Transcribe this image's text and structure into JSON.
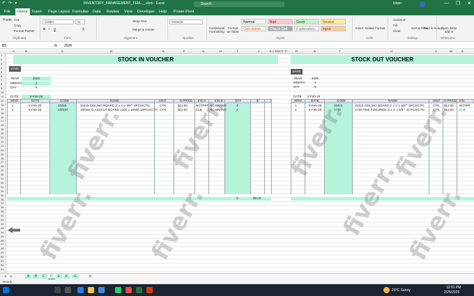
{
  "titlebar": {
    "qa": [
      "↶",
      "↷",
      "▾"
    ],
    "doc_title": "INVENTORY_MANAGEMENT_TEM..._.xlsm  ·  Excel",
    "search": "Search",
    "user": "Islam",
    "win": [
      "—",
      "❐",
      "✕"
    ]
  },
  "tabs": [
    "File",
    "Home",
    "Insert",
    "Page Layout",
    "Formulas",
    "Data",
    "Review",
    "View",
    "Developer",
    "Help",
    "Power Pivot"
  ],
  "ribbon": {
    "clipboard": [
      "Paste",
      "Cut",
      "Copy",
      "Format Painter"
    ],
    "font_name": "Calibri",
    "font_size": "11",
    "wrap_text": "Wrap Text",
    "merge": "Merge & Center",
    "number_format": "General",
    "cond_format": "Conditional Formatting",
    "format_table": "Format as Table",
    "styles": [
      "Normal",
      "Bad",
      "Good",
      "Neutral",
      "Calculation",
      "Check Cell",
      "Explanatory...",
      "Input"
    ],
    "cells": [
      "Insert",
      "Delete",
      "Format"
    ],
    "editing": [
      "AutoSum",
      "Fill",
      "Clear",
      "Sort & Filter",
      "Find & Select"
    ],
    "addin": "Open Write add-in",
    "groups": [
      "Clipboard",
      "Font",
      "Alignment",
      "Number",
      "Styles",
      "Cells",
      "Editing",
      "Writesonic"
    ],
    "style_colors": {
      "Normal": "#ffffff",
      "Bad": "#ffc7ce",
      "Good": "#c6efce",
      "Neutral": "#ffeb9c",
      "Calculation": "#f2f2f2",
      "Check Cell": "#a5a5a5",
      "Explanatory...": "#ffffff",
      "Input": "#ffcc99"
    }
  },
  "formula_bar": {
    "namebox": "B9",
    "fx": "fx",
    "content": "2026"
  },
  "columns_left": [
    "A",
    "B",
    "C",
    "D",
    "E",
    "F",
    "G",
    "H",
    "I",
    "J",
    "K",
    "L",
    "M",
    "N",
    "O",
    "P"
  ],
  "columns_right": [
    "R",
    "S",
    "T",
    "U",
    "V",
    "W",
    "X"
  ],
  "stock_in": {
    "title": "STOCK IN VOUCHER",
    "save": "SAVE",
    "year_label": "YEAR",
    "year": "2026",
    "month_label": "MONTH",
    "month": "2",
    "day_label": "DAY",
    "day": "5",
    "date_label": "DATE",
    "date": "5-Feb-26",
    "headers": [
      "S/NO",
      "DATE",
      "CODE",
      "NAME",
      "UNIT",
      "S PRICE",
      "Info A",
      "Info B",
      "QTY",
      "$"
    ],
    "rows": [
      [
        "1",
        "5-Feb-26",
        "10415",
        "10415 CEILING BOARD 2' x 4' x 5/8\"\" 8PCS/CTN",
        "CTN",
        "$12.00",
        "NOTPPF",
        "NO BRAND",
        "4",
        ""
      ],
      [
        "2",
        "5-Feb-26",
        "1801M",
        "1801M CLASSCUT BOARD 1200 x 10MM 10PCS/CTN",
        "CTN",
        "$12.00",
        "CLB",
        "NO BRAND",
        "2",
        ""
      ]
    ],
    "total_qty": "6",
    "total_amount": "$0.00"
  },
  "stock_out": {
    "title": "STOCK OUT VOUCHER",
    "save": "SAVE",
    "year_label": "YEAR",
    "year": "2026",
    "month_label": "MONTH",
    "month": "2",
    "day_label": "DAY",
    "day": "5",
    "date_label": "DATE",
    "date": "5-Feb-26",
    "headers": [
      "S/NO",
      "DATE",
      "CODE",
      "NAME",
      "UNIT",
      "S PRICE",
      "Info"
    ],
    "rows": [
      [
        "1",
        "5-Feb-26",
        "10415",
        "10415 CEILING BOARD 2' x 4' x 5/8\"\" 8PCS/CTN",
        "CTN",
        "$12.00",
        "NOTPP"
      ],
      [
        "2",
        "5-Feb-26",
        "1730",
        "1730 FINE FISSURED 2' x 4' x 5/8\"\" 10 PCS/CTN",
        "CTN",
        "$12.00",
        "CLB"
      ]
    ]
  },
  "sheet_tabs": [
    "A",
    "B",
    "C",
    "D",
    "E",
    "F",
    "G"
  ],
  "active_sheet": "D",
  "status": "Ready",
  "watermark": "fiverr.",
  "taskbar": {
    "weather": "23°C  Sunny",
    "time": "12:01 PM",
    "date": "2/25/2026"
  }
}
